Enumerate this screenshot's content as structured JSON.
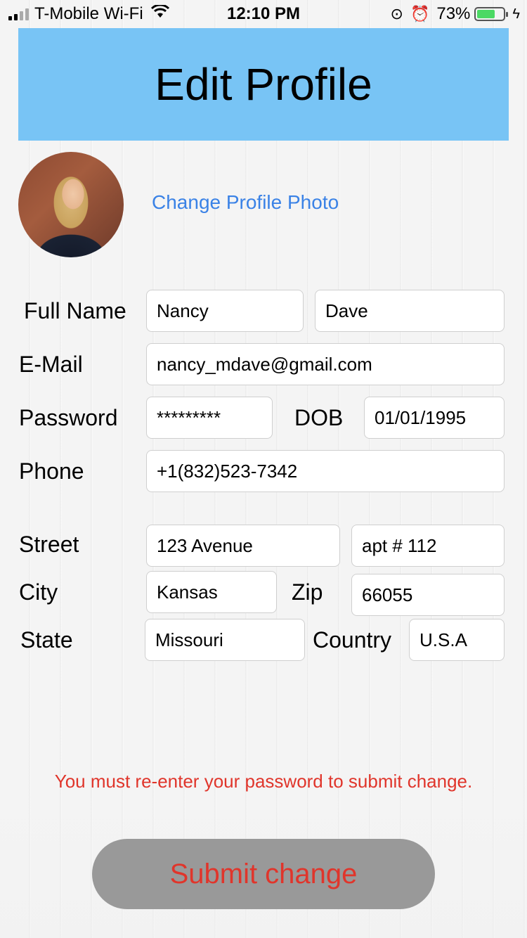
{
  "status_bar": {
    "carrier": "T-Mobile Wi-Fi",
    "time": "12:10 PM",
    "battery_percent": "73%",
    "battery_level": 0.73,
    "battery_color": "#4cd964"
  },
  "header": {
    "title": "Edit Profile",
    "background": "#78c4f5"
  },
  "profile": {
    "change_photo_label": "Change Profile Photo"
  },
  "form": {
    "labels": {
      "full_name": "Full Name",
      "email": "E-Mail",
      "password": "Password",
      "dob": "DOB",
      "phone": "Phone",
      "street": "Street",
      "city": "City",
      "zip": "Zip",
      "state": "State",
      "country": "Country"
    },
    "values": {
      "first_name": "Nancy",
      "last_name": "Dave",
      "email": "nancy_mdave@gmail.com",
      "password": "*********",
      "dob": "01/01/1995",
      "phone": "+1(832)523-7342",
      "street": "123 Avenue",
      "apt": "apt # 112",
      "city": "Kansas",
      "zip": "66055",
      "state": "Missouri",
      "country": "U.S.A"
    }
  },
  "warning_text": "You must re-enter your password to submit change.",
  "submit_label": "Submit change",
  "colors": {
    "accent_link": "#3a82e6",
    "warning": "#e0352b",
    "button_bg": "#999999"
  }
}
